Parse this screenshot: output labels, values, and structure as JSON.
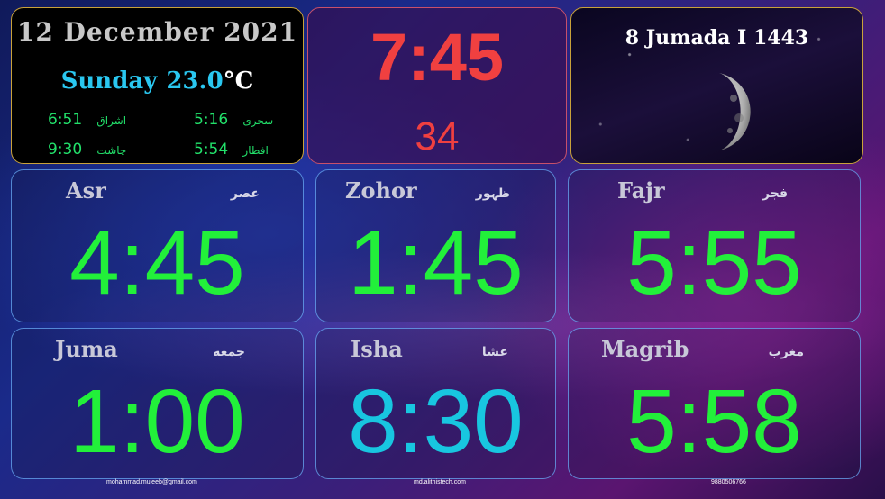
{
  "date_panel": {
    "date": "12 December 2021",
    "day": "Sunday",
    "temperature": "23.0",
    "degree_unit": "°C",
    "items": [
      {
        "time": "6:51",
        "label": "اشراق"
      },
      {
        "time": "5:16",
        "label": "سحری"
      },
      {
        "time": "9:30",
        "label": "چاشت"
      },
      {
        "time": "5:54",
        "label": "افطار"
      }
    ]
  },
  "clock": {
    "time": "7:45",
    "seconds": "34"
  },
  "hijri": {
    "date": "8 Jumada I 1443"
  },
  "prayers": [
    {
      "name": "Asr",
      "arabic": "عصر",
      "time": "4:45",
      "color": "#22f03a"
    },
    {
      "name": "Zohor",
      "arabic": "ظہور",
      "time": "1:45",
      "color": "#22f03a"
    },
    {
      "name": "Fajr",
      "arabic": "فجر",
      "time": "5:55",
      "color": "#22f03a"
    },
    {
      "name": "Juma",
      "arabic": "جمعه",
      "time": "1:00",
      "color": "#22f03a"
    },
    {
      "name": "Isha",
      "arabic": "عشا",
      "time": "8:30",
      "color": "#18c6e0"
    },
    {
      "name": "Magrib",
      "arabic": "مغرب",
      "time": "5:58",
      "color": "#22f03a"
    }
  ],
  "footer": {
    "email": "mohammad.mujeeb@gmail.com",
    "website": "md.alithistech.com",
    "phone": "9880506766"
  }
}
